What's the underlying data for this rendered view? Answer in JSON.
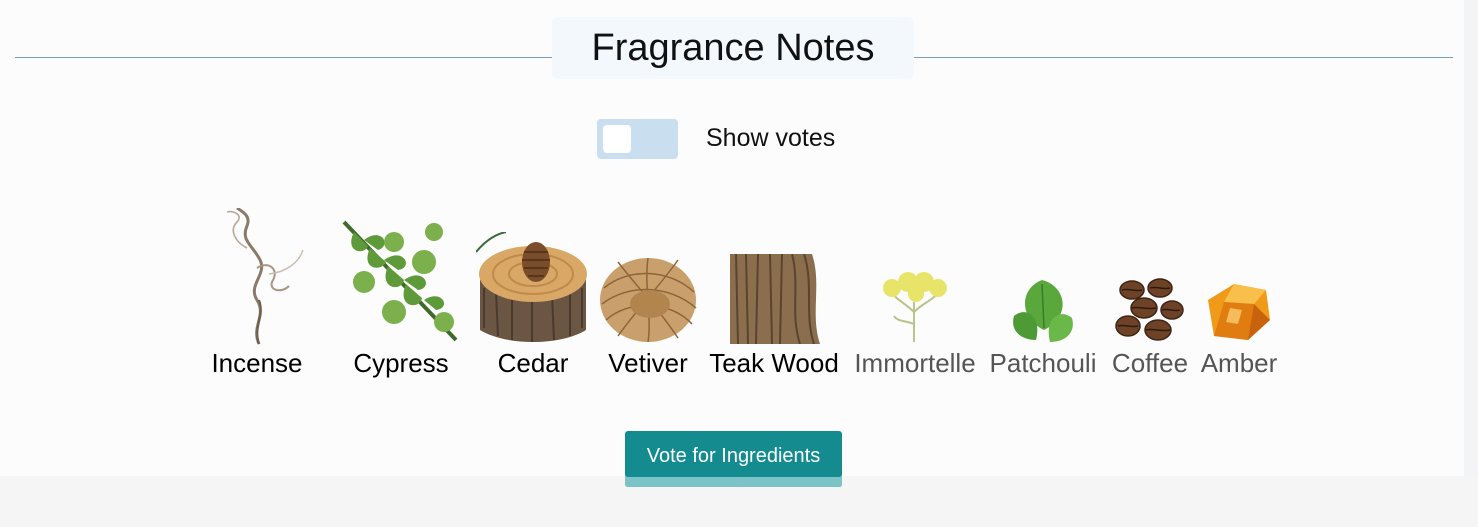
{
  "section": {
    "title": "Fragrance Notes"
  },
  "toggle": {
    "label": "Show votes",
    "checked": false
  },
  "notes": [
    {
      "name": "Incense",
      "icon": "incense-smoke-icon",
      "emphasis": "strong"
    },
    {
      "name": "Cypress",
      "icon": "cypress-branch-icon",
      "emphasis": "strong"
    },
    {
      "name": "Cedar",
      "icon": "cedar-log-pinecone-icon",
      "emphasis": "strong"
    },
    {
      "name": "Vetiver",
      "icon": "vetiver-roots-icon",
      "emphasis": "strong"
    },
    {
      "name": "Teak Wood",
      "icon": "teak-wood-icon",
      "emphasis": "strong"
    },
    {
      "name": "Immortelle",
      "icon": "immortelle-flower-icon",
      "emphasis": "light"
    },
    {
      "name": "Patchouli",
      "icon": "patchouli-leaves-icon",
      "emphasis": "light"
    },
    {
      "name": "Coffee",
      "icon": "coffee-beans-icon",
      "emphasis": "light"
    },
    {
      "name": "Amber",
      "icon": "amber-resin-icon",
      "emphasis": "light"
    }
  ],
  "vote_button": {
    "label": "Vote for Ingredients"
  },
  "colors": {
    "accent": "#138b8f",
    "accent_shadow": "#7cc3c7",
    "toggle_track": "#c9dff0",
    "rule": "#7a9eb5",
    "title_bg": "#f3f8fd"
  }
}
